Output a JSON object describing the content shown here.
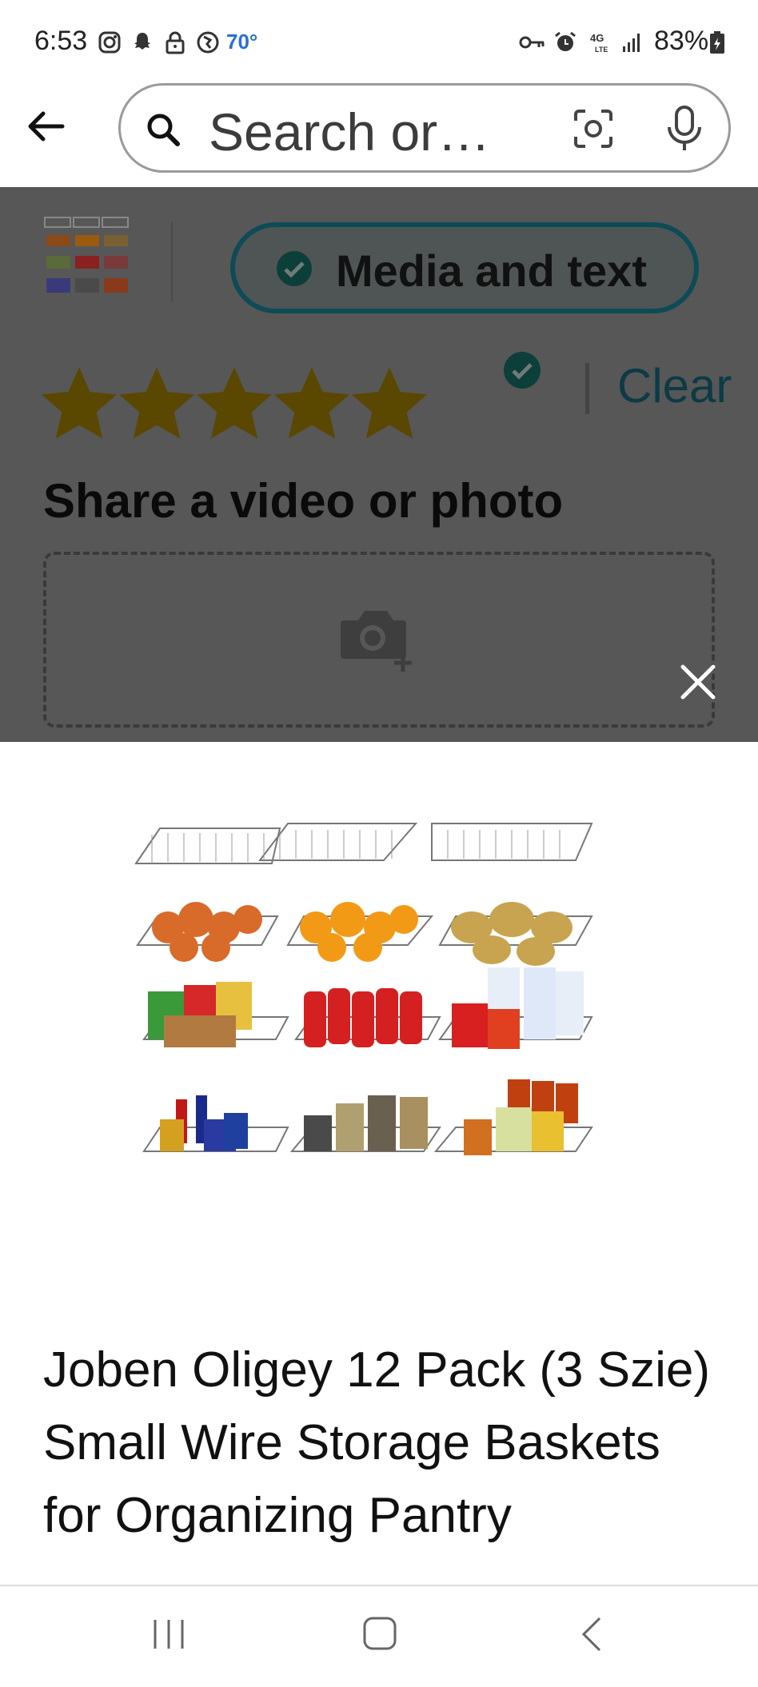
{
  "status_bar": {
    "time": "6:53",
    "temperature": "70°",
    "battery": "83%",
    "network": "4G LTE"
  },
  "search": {
    "text": "Search or…"
  },
  "review": {
    "media_toggle_label": "Media and text",
    "rating": 5,
    "rating_max": 5,
    "clear_label": "Clear",
    "share_heading": "Share a video or photo"
  },
  "product": {
    "title": "Joben Oligey 12 Pack (3 Szie) Small Wire Storage Baskets for Organizing Pantry"
  },
  "colors": {
    "dim_overlay": "#575757",
    "toggle_border": "#0d4b57",
    "star": "#5a4700",
    "link": "#0c3b45"
  },
  "icons": [
    "back-arrow-icon",
    "search-icon",
    "camera-icon",
    "mic-icon",
    "check-icon",
    "star-icon",
    "close-icon",
    "camera-add-icon",
    "nav-recent-icon",
    "nav-home-icon",
    "nav-back-icon"
  ]
}
